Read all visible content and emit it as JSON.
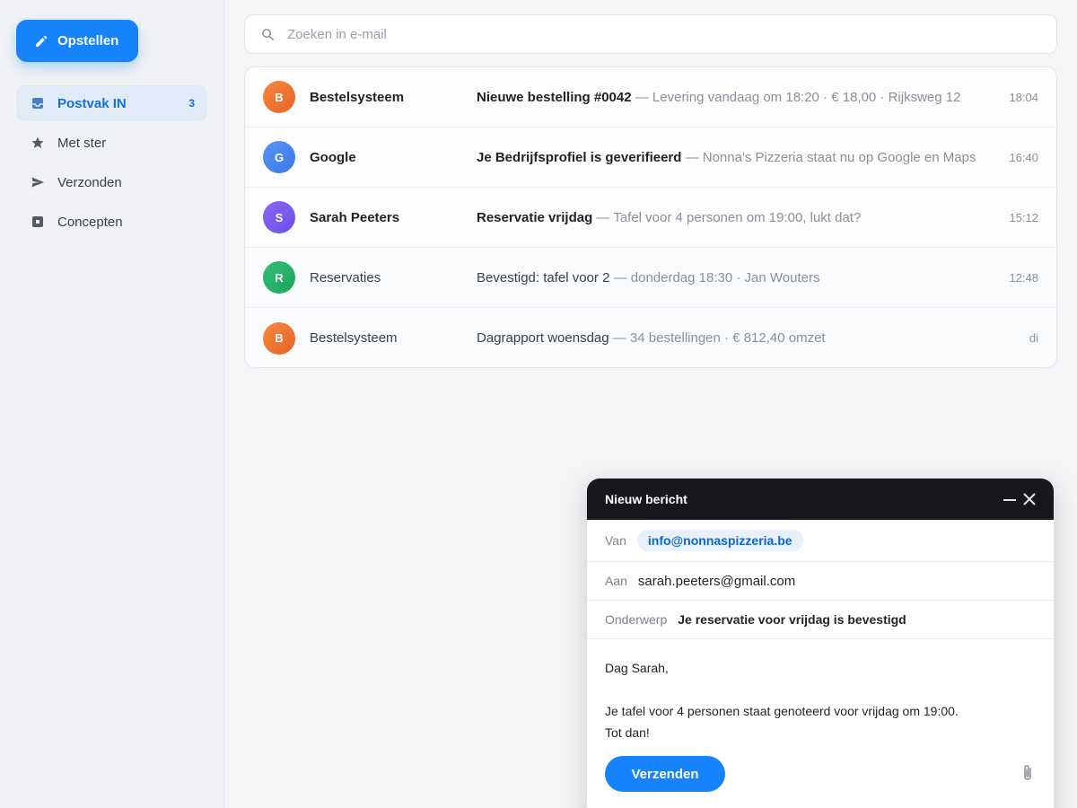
{
  "sidebar": {
    "compose_label": "Opstellen",
    "items": [
      {
        "label": "Postvak IN",
        "count": "3",
        "icon": "inbox-icon"
      },
      {
        "label": "Met ster",
        "icon": "star-icon"
      },
      {
        "label": "Verzonden",
        "icon": "send-icon"
      },
      {
        "label": "Concepten",
        "icon": "draft-icon"
      }
    ]
  },
  "search": {
    "placeholder": "Zoeken in e-mail"
  },
  "colors": {
    "accent": "#1683fb",
    "avatar_orange": "#f07a30",
    "avatar_blue": "#4a86ee",
    "avatar_purple": "#7a5cf0",
    "avatar_green": "#27b26a"
  },
  "mails": [
    {
      "initial": "B",
      "sender": "Bestelsysteem",
      "subject": "Nieuwe bestelling #0042",
      "snippet": " — Levering vandaag om 18:20 · € 18,00 · Rijksweg 12",
      "time": "18:04",
      "unread": true
    },
    {
      "initial": "G",
      "sender": "Google",
      "subject": "Je Bedrijfsprofiel is geverifieerd",
      "snippet": " — Nonna's Pizzeria staat nu op Google en Maps",
      "time": "16:40",
      "unread": true
    },
    {
      "initial": "S",
      "sender": "Sarah Peeters",
      "subject": "Reservatie vrijdag",
      "snippet": " — Tafel voor 4 personen om 19:00, lukt dat?",
      "time": "15:12",
      "unread": true
    },
    {
      "initial": "R",
      "sender": "Reservaties",
      "subject": "Bevestigd: tafel voor 2",
      "snippet": " — donderdag 18:30 · Jan Wouters",
      "time": "12:48",
      "unread": false
    },
    {
      "initial": "B",
      "sender": "Bestelsysteem",
      "subject": "Dagrapport woensdag",
      "snippet": " — 34 bestellingen · € 812,40 omzet",
      "time": "di",
      "unread": false
    }
  ],
  "composer": {
    "title": "Nieuw bericht",
    "from_label": "Van",
    "from_value": "info@nonnaspizzeria.be",
    "to_label": "Aan",
    "to_value": "sarah.peeters@gmail.com",
    "subject_label": "Onderwerp",
    "subject_value": "Je reservatie voor vrijdag is bevestigd",
    "body": {
      "greeting": "Dag Sarah,",
      "line1": "Je tafel voor 4 personen staat genoteerd voor vrijdag om 19:00.",
      "line2": "Tot dan!"
    },
    "send_label": "Verzenden"
  }
}
